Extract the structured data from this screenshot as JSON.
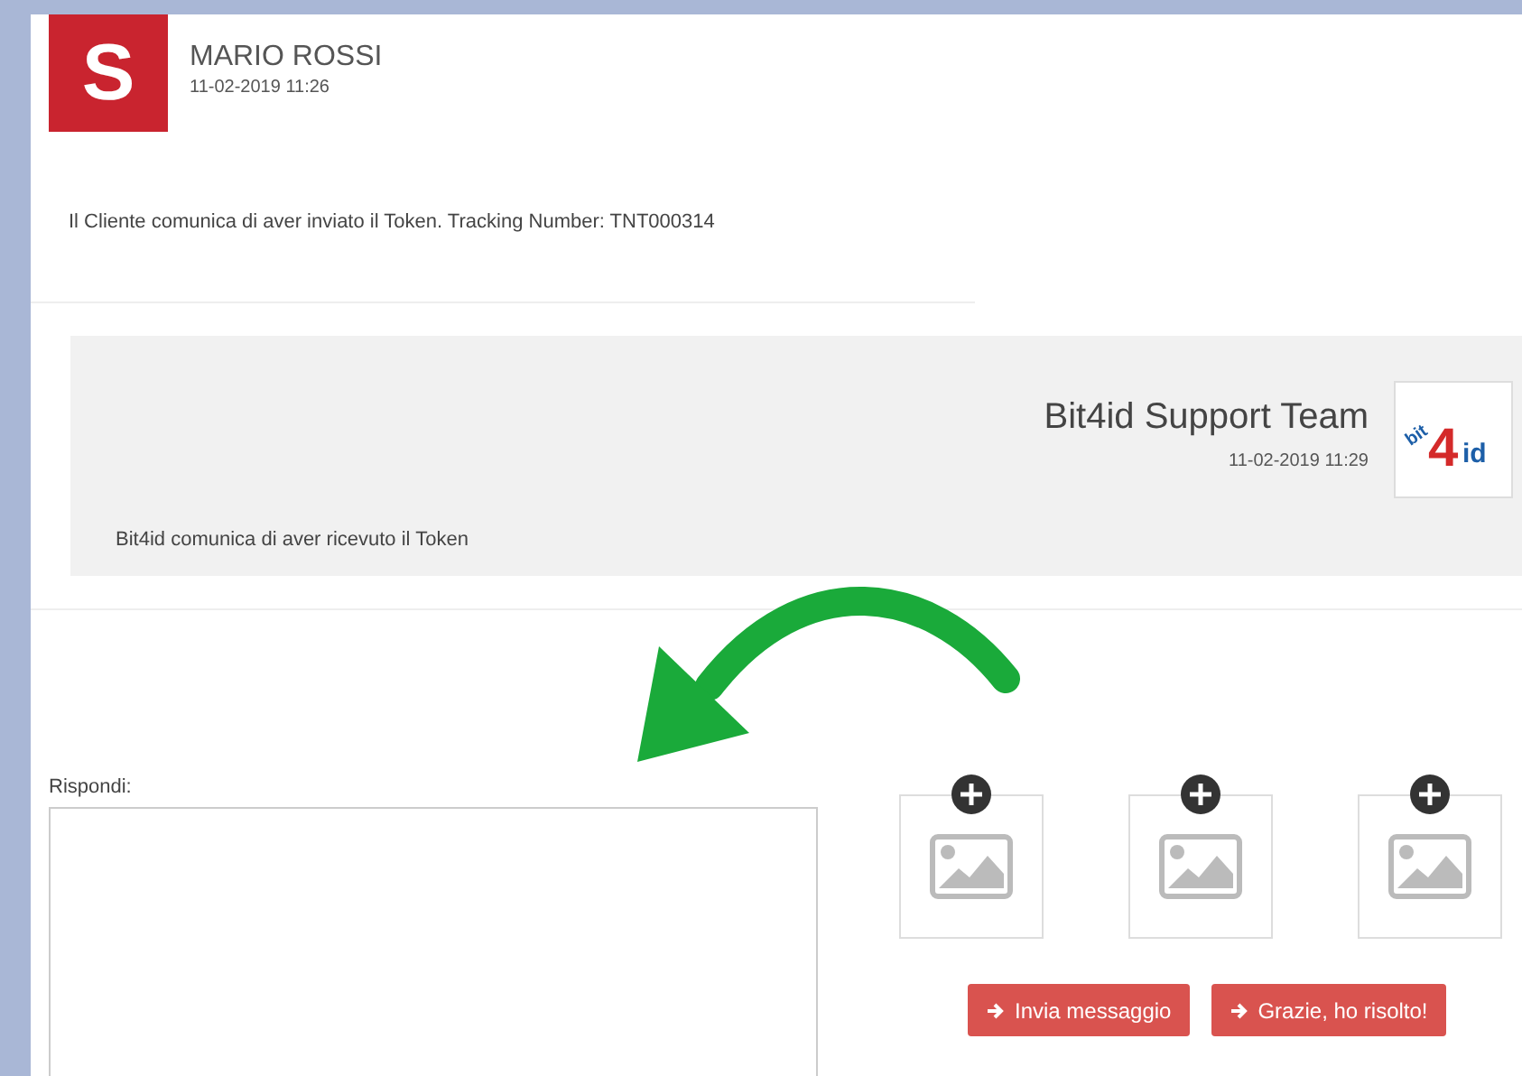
{
  "messages": [
    {
      "kind": "customer",
      "avatar_letter": "S",
      "author": "MARIO ROSSI",
      "time": "11-02-2019 11:26",
      "text": "Il Cliente comunica di aver inviato il Token. Tracking Number: TNT000314"
    },
    {
      "kind": "support",
      "logo_parts": [
        "bit",
        "4",
        "id"
      ],
      "author": "Bit4id Support Team",
      "time": "11-02-2019 11:29",
      "text": "Bit4id comunica di aver ricevuto il Token"
    }
  ],
  "reply": {
    "label": "Rispondi:"
  },
  "attachments": [
    {
      "kind": "empty"
    },
    {
      "kind": "empty"
    },
    {
      "kind": "empty"
    }
  ],
  "buttons": [
    {
      "label": "Invia messaggio"
    },
    {
      "label": "Grazie, ho risolto!"
    }
  ]
}
